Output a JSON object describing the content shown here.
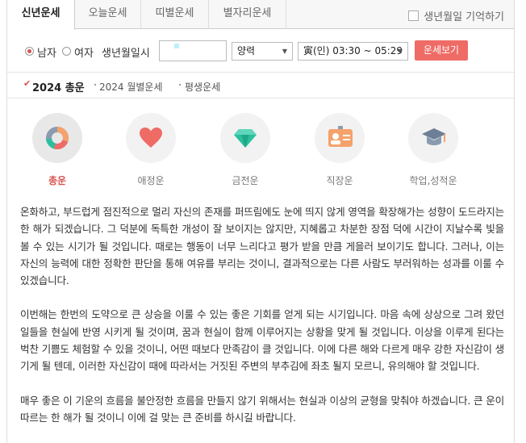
{
  "tabs": [
    {
      "label": "신년운세",
      "active": true
    },
    {
      "label": "오늘운세",
      "active": false
    },
    {
      "label": "띠별운세",
      "active": false
    },
    {
      "label": "별자리운세",
      "active": false
    }
  ],
  "remember_label": "생년월일 기억하기",
  "form": {
    "gender_male": "남자",
    "gender_female": "여자",
    "selected_gender": "남자",
    "birth_label": "생년월일시",
    "birth_value": "",
    "calendar_value": "양력",
    "time_value": "寅(인) 03:30 ~ 05:29",
    "submit_label": "운세보기"
  },
  "subtabs": [
    {
      "label": "2024 총운",
      "active": true
    },
    {
      "label": "2024 월별운세",
      "active": false
    },
    {
      "label": "평생운세",
      "active": false
    }
  ],
  "categories": [
    {
      "label": "총운",
      "icon": "donut-chart-icon",
      "active": true
    },
    {
      "label": "애정운",
      "icon": "heart-icon",
      "active": false
    },
    {
      "label": "금전운",
      "icon": "diamond-icon",
      "active": false
    },
    {
      "label": "직장운",
      "icon": "id-badge-icon",
      "active": false
    },
    {
      "label": "학업,성적운",
      "icon": "graduation-cap-icon",
      "active": false
    }
  ],
  "colors": {
    "accent": "#ef6b66",
    "active_text": "#d9534f",
    "heart": "#ef6b66",
    "diamond": "#2bbf9e",
    "badge": "#f5a26b",
    "cap": "#6c7f96"
  },
  "content": {
    "p1": "온화하고, 부드럽게 점진적으로 멀리 자신의 존재를 퍼뜨림에도 눈에 띄지 않게 영역을 확장해가는 성향이 도드라지는 한 해가 되겠습니다. 그 덕분에 독특한 개성이 잘 보이지는 않지만, 지혜롭고 차분한 장점 덕에 시간이 지날수록 빛을 볼 수 있는 시기가 될 것입니다. 때로는 행동이 너무 느리다고 평가 받을 만큼 게을러 보이기도 합니다. 그러나, 이는 자신의 능력에 대한 정확한 판단을 통해 여유를 부리는 것이니, 결과적으로는 다른 사람도 부러워하는 성과를 이룰 수 있겠습니다.",
    "p2": "이번해는 한번의 도약으로 큰 상승을 이룰 수 있는 좋은 기회를 얻게 되는 시기입니다. 마음 속에 상상으로 그려 왔던 일들을 현실에 반영 시키게 될 것이며, 꿈과 현실이 함께 이루어지는 상황을 맞게 될 것입니다. 이상을 이루게 된다는 벅찬 기쁨도 체험할 수 있을 것이니, 어떤 때보다 만족감이 클 것입니다. 이에 다른 해와 다르게 매우 강한 자신감이 생기게 될 텐데, 이러한 자신감이 때에 따라서는 거짓된 주변의 부추김에 좌초 될지 모르니, 유의해야 할 것입니다.",
    "p3": "매우 좋은 이 기운의 흐름을 불안정한 흐름을 만들지 않기 위해서는 현실과 이상의 균형을 맞춰야 하겠습니다. 큰 운이 따르는 한 해가 될 것이니 이에 걸 맞는 큰 준비를 하시길 바랍니다."
  }
}
